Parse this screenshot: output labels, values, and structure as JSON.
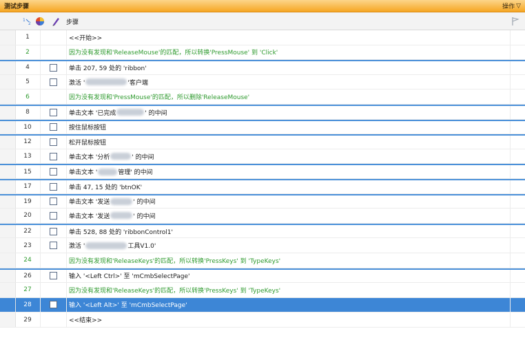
{
  "window": {
    "title": "测试步骤",
    "ops_label": "操作",
    "ops_arrow": "▽"
  },
  "header": {
    "col_steps": "步骤"
  },
  "rows": [
    {
      "num": "1",
      "kind": "plain",
      "check": false,
      "parts": [
        "<<开始>>"
      ]
    },
    {
      "num": "2",
      "kind": "green",
      "check": false,
      "parts": [
        "因为没有发现和'ReleaseMouse'的匹配，所以转换'PressMouse' 到 'Click'"
      ]
    },
    {
      "num": "4",
      "kind": "plain",
      "check": true,
      "sep": true,
      "parts": [
        "单击 207, 59 处的 'ribbon'"
      ]
    },
    {
      "num": "5",
      "kind": "plain",
      "check": true,
      "parts": [
        "激活 '",
        "",
        "'客户端"
      ]
    },
    {
      "num": "6",
      "kind": "green",
      "check": false,
      "parts": [
        "因为没有发现和'PressMouse'的匹配，所以删除'ReleaseMouse'"
      ]
    },
    {
      "num": "8",
      "kind": "plain",
      "check": true,
      "sep": true,
      "parts": [
        "单击文本 '已完成",
        "",
        "' 的中间"
      ]
    },
    {
      "num": "10",
      "kind": "plain",
      "check": true,
      "sep": true,
      "parts": [
        "按住鼠标按钮"
      ]
    },
    {
      "num": "12",
      "kind": "plain",
      "check": true,
      "sep": true,
      "parts": [
        "松开鼠标按钮"
      ]
    },
    {
      "num": "13",
      "kind": "plain",
      "check": true,
      "parts": [
        "单击文本 '分析",
        "",
        "' 的中间"
      ]
    },
    {
      "num": "15",
      "kind": "plain",
      "check": true,
      "sep": true,
      "parts": [
        "单击文本 '",
        "",
        "管理' 的中间"
      ]
    },
    {
      "num": "17",
      "kind": "plain",
      "check": true,
      "sep": true,
      "parts": [
        "单击 47, 15 处的 'btnOK'"
      ]
    },
    {
      "num": "19",
      "kind": "plain",
      "check": true,
      "sep": true,
      "parts": [
        "单击文本 '发送",
        "",
        "' 的中间"
      ]
    },
    {
      "num": "20",
      "kind": "plain",
      "check": true,
      "parts": [
        "单击文本 '发送",
        "",
        "' 的中间"
      ]
    },
    {
      "num": "22",
      "kind": "plain",
      "check": true,
      "sep": true,
      "parts": [
        "单击 528, 88 处的 'ribbonControl1'"
      ]
    },
    {
      "num": "23",
      "kind": "plain",
      "check": true,
      "parts": [
        "激活 '",
        "",
        "工具V1.0'"
      ]
    },
    {
      "num": "24",
      "kind": "green",
      "check": false,
      "parts": [
        "因为没有发现和'ReleaseKeys'的匹配，所以转换'PressKeys' 到 'TypeKeys'"
      ]
    },
    {
      "num": "26",
      "kind": "plain",
      "check": true,
      "sep": true,
      "parts": [
        "输入 '<Left Ctrl>' 至 'mCmbSelectPage'"
      ]
    },
    {
      "num": "27",
      "kind": "green",
      "check": false,
      "parts": [
        "因为没有发现和'ReleaseKeys'的匹配，所以转换'PressKeys' 到 'TypeKeys'"
      ]
    },
    {
      "num": "28",
      "kind": "selected",
      "check": true,
      "parts": [
        "输入 '<Left Alt>' 至 'mCmbSelectPage'"
      ]
    },
    {
      "num": "29",
      "kind": "plain",
      "check": false,
      "parts": [
        "<<结束>>"
      ]
    }
  ]
}
